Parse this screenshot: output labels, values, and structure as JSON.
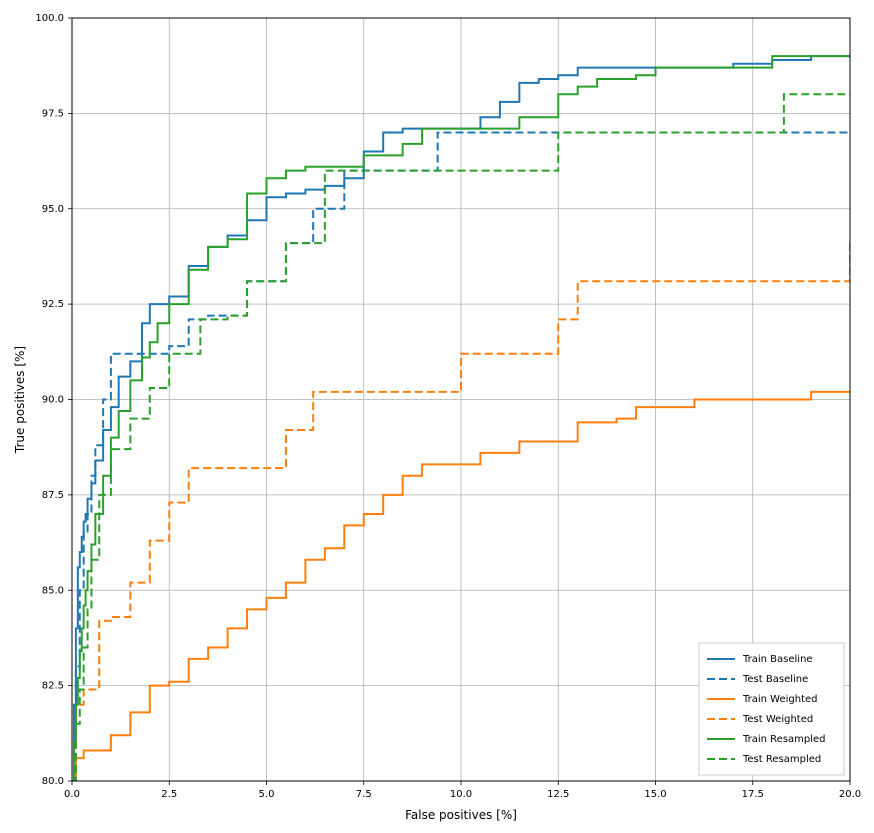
{
  "chart_data": {
    "type": "line",
    "xlabel": "False positives [%]",
    "ylabel": "True positives [%]",
    "xlim": [
      0,
      20
    ],
    "ylim": [
      80,
      100
    ],
    "xticks": [
      0.0,
      2.5,
      5.0,
      7.5,
      10.0,
      12.5,
      15.0,
      17.5,
      20.0
    ],
    "yticks": [
      80.0,
      82.5,
      85.0,
      87.5,
      90.0,
      92.5,
      95.0,
      97.5,
      100.0
    ],
    "grid": true,
    "legend_position": "lower right",
    "series": [
      {
        "name": "Train Baseline",
        "color": "#1f77b4",
        "dash": "solid",
        "x": [
          0.0,
          0.05,
          0.1,
          0.15,
          0.2,
          0.25,
          0.3,
          0.35,
          0.4,
          0.5,
          0.6,
          0.8,
          1.0,
          1.2,
          1.5,
          1.8,
          2.0,
          2.2,
          2.5,
          3.0,
          3.5,
          4.0,
          4.5,
          5.0,
          5.5,
          6.0,
          6.5,
          7.0,
          7.5,
          8.0,
          8.5,
          9.0,
          9.5,
          10.0,
          10.5,
          11.0,
          11.5,
          12.0,
          12.5,
          13.0,
          14.0,
          15.0,
          16.0,
          17.0,
          18.0,
          19.0,
          20.0
        ],
        "y": [
          80.0,
          82.0,
          84.0,
          85.6,
          86.0,
          86.4,
          86.8,
          87.0,
          87.4,
          87.8,
          88.4,
          89.2,
          89.8,
          90.6,
          91.0,
          92.0,
          92.5,
          92.5,
          92.7,
          93.5,
          94.0,
          94.3,
          94.7,
          95.3,
          95.4,
          95.5,
          95.6,
          95.8,
          96.5,
          97.0,
          97.1,
          97.1,
          97.1,
          97.1,
          97.4,
          97.8,
          98.3,
          98.4,
          98.5,
          98.7,
          98.7,
          98.7,
          98.7,
          98.8,
          98.9,
          99.0,
          99.0
        ]
      },
      {
        "name": "Test Baseline",
        "color": "#1f77b4",
        "dash": "dashed",
        "x": [
          0.0,
          0.1,
          0.2,
          0.3,
          0.4,
          0.5,
          0.6,
          0.8,
          0.9,
          1.0,
          1.5,
          2.0,
          2.5,
          3.0,
          3.2,
          3.5,
          4.0,
          4.5,
          5.0,
          5.5,
          6.0,
          6.2,
          6.5,
          7.0,
          7.5,
          8.0,
          9.0,
          9.3,
          9.4,
          10.0,
          12.0,
          14.0,
          16.0,
          18.0,
          20.0
        ],
        "y": [
          80.0,
          83.0,
          85.0,
          86.5,
          87.0,
          88.0,
          88.8,
          90.0,
          90.0,
          91.2,
          91.2,
          91.2,
          91.4,
          92.1,
          92.1,
          92.2,
          92.2,
          93.1,
          93.1,
          94.1,
          94.1,
          95.0,
          95.0,
          96.0,
          96.0,
          96.0,
          96.0,
          96.0,
          97.0,
          97.0,
          97.0,
          97.0,
          97.0,
          97.0,
          97.0
        ]
      },
      {
        "name": "Train Weighted",
        "color": "#ff7f0e",
        "dash": "solid",
        "x": [
          0.0,
          0.1,
          0.2,
          0.3,
          0.5,
          0.8,
          1.0,
          1.5,
          2.0,
          2.5,
          3.0,
          3.5,
          4.0,
          4.5,
          5.0,
          5.5,
          6.0,
          6.5,
          7.0,
          7.5,
          8.0,
          8.5,
          9.0,
          9.5,
          10.0,
          10.5,
          11.5,
          12.5,
          13.0,
          14.0,
          14.5,
          15.0,
          16.0,
          17.0,
          18.0,
          19.0,
          19.5,
          20.0
        ],
        "y": [
          80.0,
          80.6,
          80.6,
          80.8,
          80.8,
          80.8,
          81.2,
          81.8,
          82.5,
          82.6,
          83.2,
          83.5,
          84.0,
          84.5,
          84.8,
          85.2,
          85.8,
          86.1,
          86.7,
          87.0,
          87.5,
          88.0,
          88.3,
          88.3,
          88.3,
          88.6,
          88.9,
          88.9,
          89.4,
          89.5,
          89.8,
          89.8,
          90.0,
          90.0,
          90.0,
          90.2,
          90.2,
          90.2
        ]
      },
      {
        "name": "Test Weighted",
        "color": "#ff7f0e",
        "dash": "dashed",
        "x": [
          0.0,
          0.1,
          0.3,
          0.5,
          0.7,
          1.0,
          1.5,
          2.0,
          2.3,
          2.5,
          3.0,
          4.0,
          5.0,
          5.5,
          6.0,
          6.2,
          7.0,
          8.0,
          9.0,
          9.5,
          10.0,
          11.0,
          12.0,
          12.5,
          13.0,
          14.0,
          15.0,
          16.0,
          17.0,
          18.0,
          19.0,
          19.6,
          20.0
        ],
        "y": [
          80.0,
          82.0,
          82.4,
          82.4,
          84.2,
          84.3,
          85.2,
          86.3,
          86.3,
          87.3,
          88.2,
          88.2,
          88.2,
          89.2,
          89.2,
          90.2,
          90.2,
          90.2,
          90.2,
          90.2,
          91.2,
          91.2,
          91.2,
          92.1,
          93.1,
          93.1,
          93.1,
          93.1,
          93.1,
          93.1,
          93.1,
          93.1,
          94.1
        ]
      },
      {
        "name": "Train Resampled",
        "color": "#2ca02c",
        "dash": "solid",
        "x": [
          0.0,
          0.05,
          0.1,
          0.15,
          0.2,
          0.25,
          0.3,
          0.35,
          0.4,
          0.5,
          0.6,
          0.8,
          1.0,
          1.2,
          1.5,
          1.8,
          2.0,
          2.2,
          2.5,
          3.0,
          3.5,
          4.0,
          4.5,
          5.0,
          5.5,
          6.0,
          6.5,
          7.0,
          7.5,
          8.5,
          9.0,
          9.5,
          10.0,
          11.5,
          12.5,
          13.0,
          13.5,
          14.5,
          15.0,
          16.0,
          17.0,
          18.0,
          19.0,
          20.0
        ],
        "y": [
          80.0,
          81.0,
          82.0,
          82.7,
          83.4,
          84.0,
          84.6,
          85.0,
          85.5,
          86.2,
          87.0,
          88.0,
          89.0,
          89.7,
          90.5,
          91.1,
          91.5,
          92.0,
          92.5,
          93.4,
          94.0,
          94.2,
          95.4,
          95.8,
          96.0,
          96.1,
          96.1,
          96.1,
          96.4,
          96.7,
          97.1,
          97.1,
          97.1,
          97.4,
          98.0,
          98.2,
          98.4,
          98.5,
          98.7,
          98.7,
          98.7,
          99.0,
          99.0,
          99.0
        ]
      },
      {
        "name": "Test Resampled",
        "color": "#2ca02c",
        "dash": "dashed",
        "x": [
          0.0,
          0.1,
          0.2,
          0.3,
          0.4,
          0.5,
          0.7,
          1.0,
          1.5,
          2.0,
          2.5,
          3.0,
          3.3,
          3.5,
          4.0,
          4.5,
          5.0,
          5.5,
          6.0,
          6.5,
          7.0,
          8.0,
          9.0,
          10.0,
          11.0,
          12.0,
          12.5,
          14.0,
          16.0,
          18.0,
          18.3,
          20.0
        ],
        "y": [
          80.0,
          81.5,
          82.4,
          83.5,
          84.5,
          85.8,
          87.5,
          88.7,
          89.5,
          90.3,
          91.2,
          91.2,
          92.1,
          92.1,
          92.2,
          93.1,
          93.1,
          94.1,
          94.1,
          96.0,
          96.0,
          96.0,
          96.0,
          96.0,
          96.0,
          96.0,
          97.0,
          97.0,
          97.0,
          97.0,
          98.0,
          98.0
        ]
      }
    ]
  }
}
